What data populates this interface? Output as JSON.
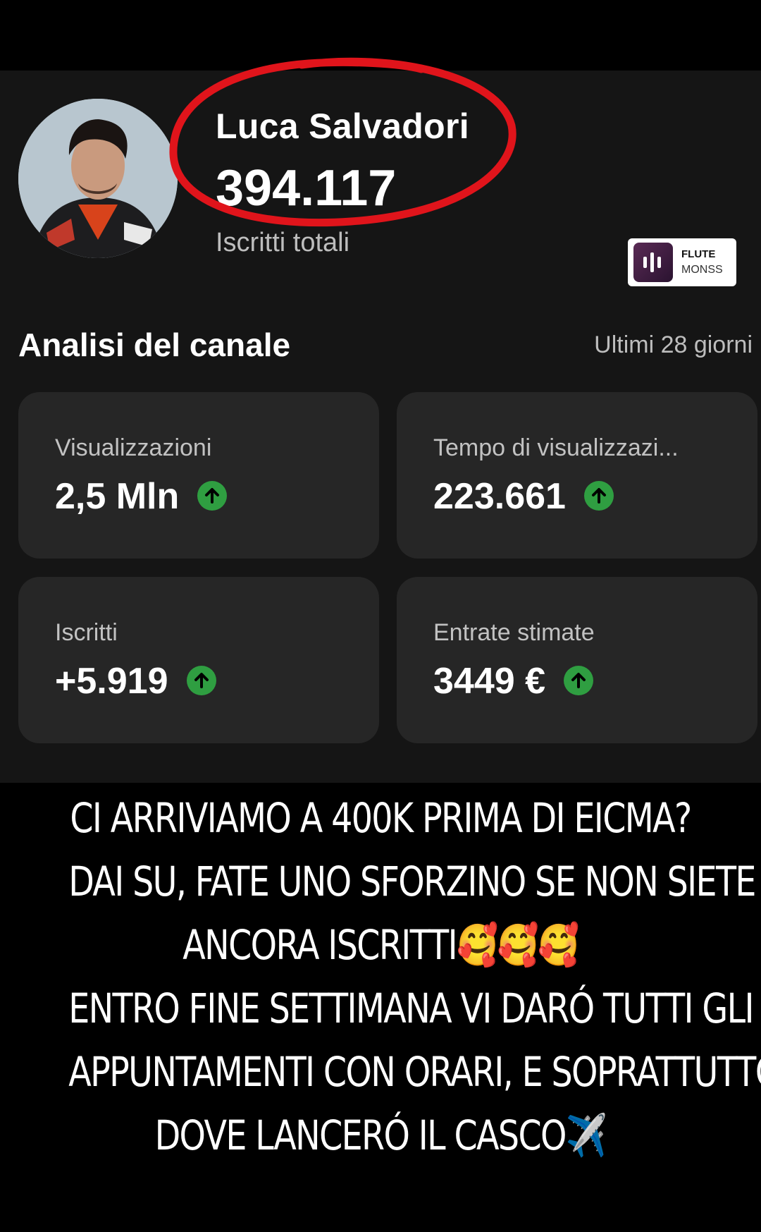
{
  "channel": {
    "name": "Luca Salvadori",
    "total_subscribers": "394.117",
    "total_label": "Iscritti totali"
  },
  "watermark": {
    "line1": "FLUTE",
    "line2": "MONSS"
  },
  "analytics": {
    "title": "Analisi del canale",
    "period": "Ultimi 28 giorni",
    "cards": [
      {
        "label": "Visualizzazioni",
        "value": "2,5 Mln",
        "trend": "up"
      },
      {
        "label": "Tempo di visualizzazi...",
        "value": "223.661",
        "trend": "up"
      },
      {
        "label": "Iscritti",
        "value": "+5.919",
        "trend": "up"
      },
      {
        "label": "Entrate stimate",
        "value": "3449 €",
        "trend": "up"
      }
    ]
  },
  "caption": {
    "lines": [
      "CI ARRIVIAMO A 400K PRIMA DI EICMA?",
      "DAI SU, FATE UNO SFORZINO SE NON SIETE",
      "ANCORA ISCRITTI🥰🥰🥰",
      "ENTRO FINE SETTIMANA VI DARÓ TUTTI GLI",
      "APPUNTAMENTI CON ORARI, E SOPRATTUTTO",
      "DOVE LANCERÓ IL CASCO✈️"
    ]
  },
  "colors": {
    "background": "#000000",
    "panel": "#151515",
    "card": "#262626",
    "trend_up": "#2f9e41",
    "annotation_circle": "#e0141b"
  }
}
